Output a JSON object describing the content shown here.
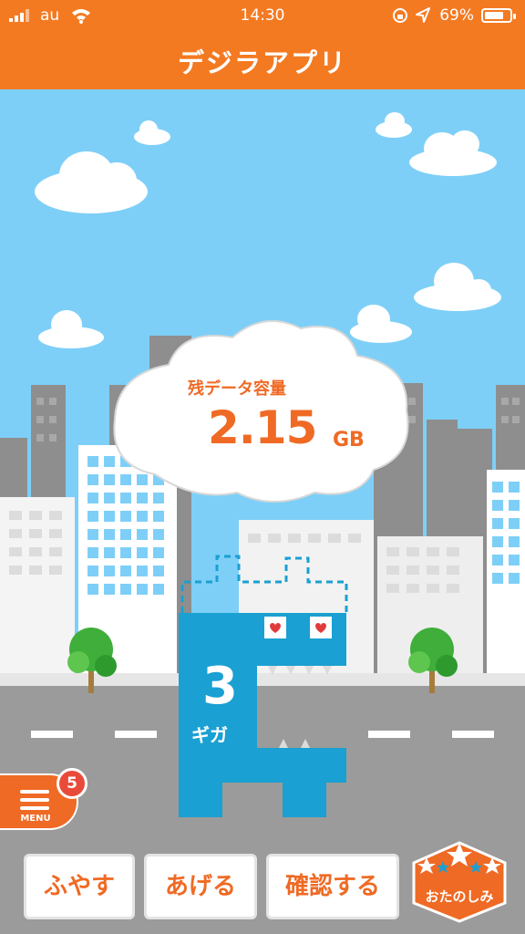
{
  "status_bar": {
    "carrier": "au",
    "time": "14:30",
    "battery": "69%"
  },
  "header": {
    "title": "デジラアプリ"
  },
  "data_remaining": {
    "label": "残データ容量",
    "value": "2.15",
    "unit": "GB"
  },
  "character": {
    "digit": "3",
    "unit_text": "ギガ"
  },
  "menu": {
    "label": "MENU",
    "badge_count": "5"
  },
  "actions": [
    {
      "label": "ふやす"
    },
    {
      "label": "あげる"
    },
    {
      "label": "確認する"
    }
  ],
  "fun_button": {
    "label": "おたのしみ"
  },
  "colors": {
    "brand": "#f47a22",
    "accent_text": "#ef6a24",
    "sky": "#7ecff7",
    "monster": "#1aa0d2",
    "badge": "#e84b3a"
  }
}
